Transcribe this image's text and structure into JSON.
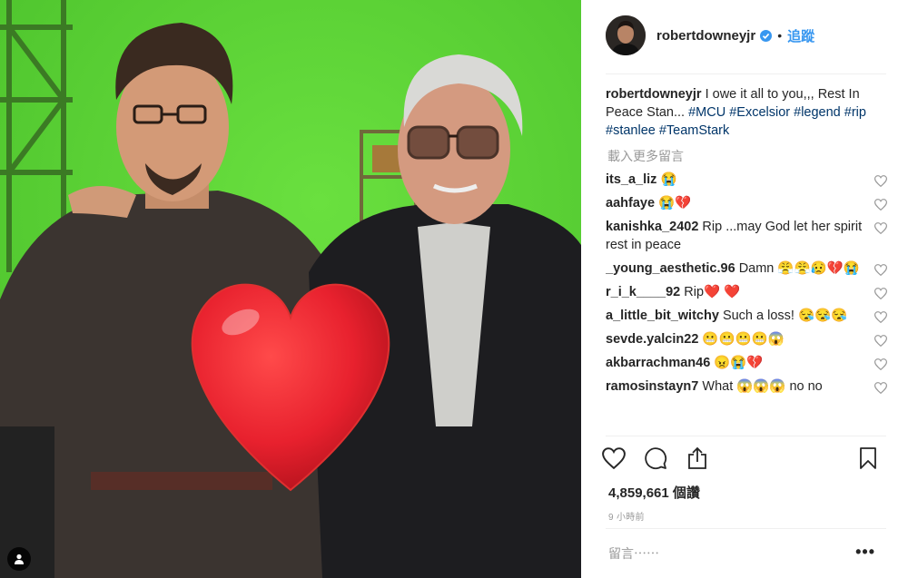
{
  "post": {
    "username": "robertdowneyjr",
    "follow_label": "追蹤",
    "dot": "•",
    "caption": {
      "username": "robertdowneyjr",
      "text": "I owe it all to you,,, Rest In Peace Stan...",
      "hashtags": [
        "#MCU",
        "#Excelsior",
        "#legend",
        "#rip",
        "#stanlee",
        "#TeamStark"
      ]
    },
    "load_more_label": "載入更多留言",
    "comments": [
      {
        "user": "its_a_liz",
        "text": "😭"
      },
      {
        "user": "aahfaye",
        "text": "😭💔"
      },
      {
        "user": "kanishka_2402",
        "text": "Rip ...may God let her spirit rest in peace"
      },
      {
        "user": "_young_aesthetic.96",
        "text": "Damn 😤😤😥💔😭"
      },
      {
        "user": "r_i_k____92",
        "text": "Rip❤️ ❤️"
      },
      {
        "user": "a_little_bit_witchy",
        "text": "Such a loss! 😪😪😪"
      },
      {
        "user": "sevde.yalcin22",
        "text": "😬😬😬😬😱"
      },
      {
        "user": "akbarrachman46",
        "text": "😠😭💔"
      },
      {
        "user": "ramosinstayn7",
        "text": "What 😱😱😱  no no"
      }
    ],
    "likes_text": "4,859,661 個讚",
    "time_text": "9 小時前",
    "add_comment_placeholder": "留言⋯⋯",
    "more_label": "•••"
  },
  "colors": {
    "accent": "#3897f0",
    "hashtag": "#003569",
    "green_screen": "#5fd23a",
    "heart": "#e8212e"
  }
}
